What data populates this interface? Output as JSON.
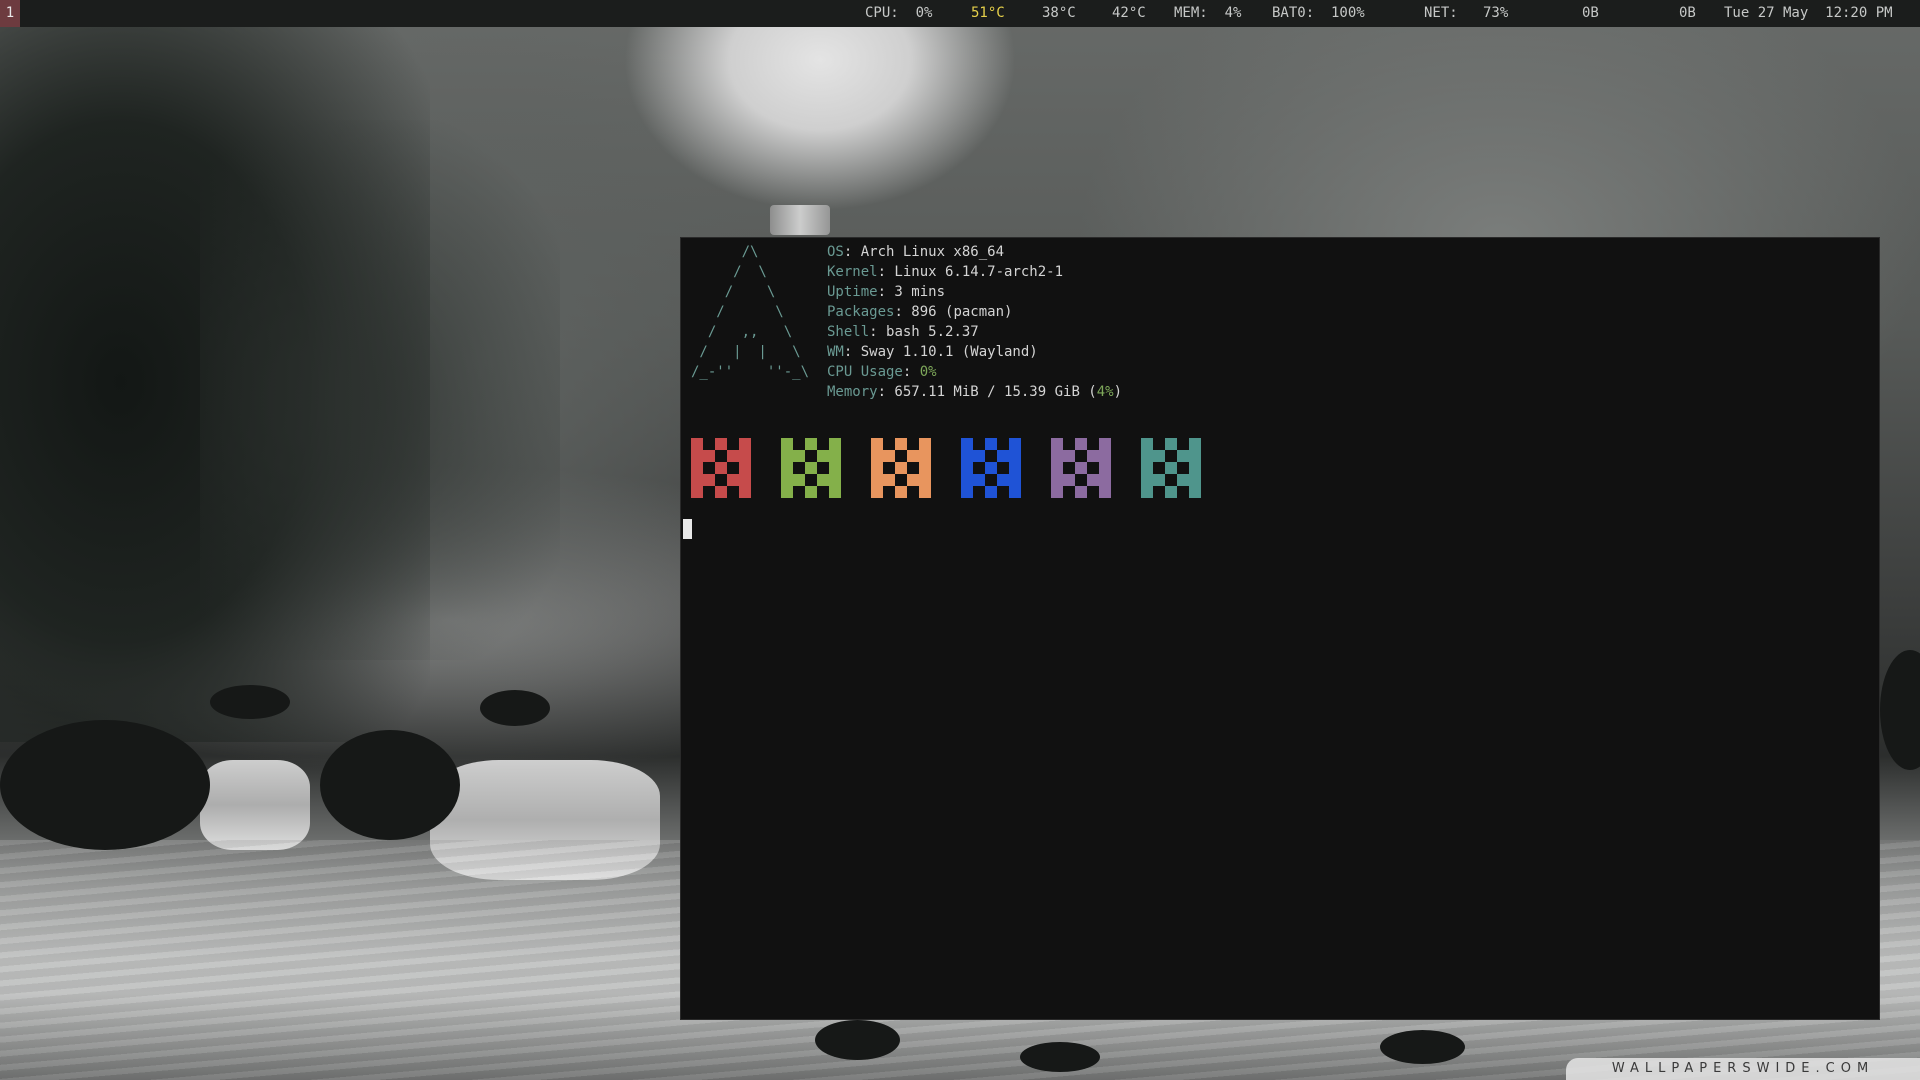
{
  "topbar": {
    "workspace": "1",
    "cpu": "CPU:  0%",
    "temp1": "51°C",
    "temp2": "38°C",
    "temp3": "42°C",
    "mem": "MEM:  4%",
    "battery": "BAT0:  100%",
    "net": "NET:   73%",
    "net_down": "0B",
    "net_up": "0B",
    "datetime": "Tue 27 May  12:20 PM",
    "temp1_color": "#e6d04a"
  },
  "terminal": {
    "logo": "      /\\\n     /  \\\n    /    \\\n   /      \\\n  /   ,,   \\\n /   |  |   \\\n/_-''    ''-_\\",
    "info": [
      {
        "key": "OS",
        "value": ": Arch Linux x86_64"
      },
      {
        "key": "Kernel",
        "value": ": Linux 6.14.7-arch2-1"
      },
      {
        "key": "Uptime",
        "value": ": 3 mins"
      },
      {
        "key": "Packages",
        "value": ": 896 (pacman)"
      },
      {
        "key": "Shell",
        "value": ": bash 5.2.37"
      },
      {
        "key": "WM",
        "value": ": Sway 1.10.1 (Wayland)"
      },
      {
        "key": "CPU Usage",
        "value": ": ",
        "hl": "0%"
      },
      {
        "key": "Memory",
        "value": ": 657.11 MiB / 15.39 GiB (",
        "hl": "4%",
        "tail": ")"
      }
    ],
    "palette": [
      "#c64b4b",
      "#84b04a",
      "#e8955e",
      "#1f53d6",
      "#8c6ba0",
      "#4f958c"
    ]
  },
  "wallpaper": {
    "watermark": "WALLPAPERSWIDE.COM"
  }
}
